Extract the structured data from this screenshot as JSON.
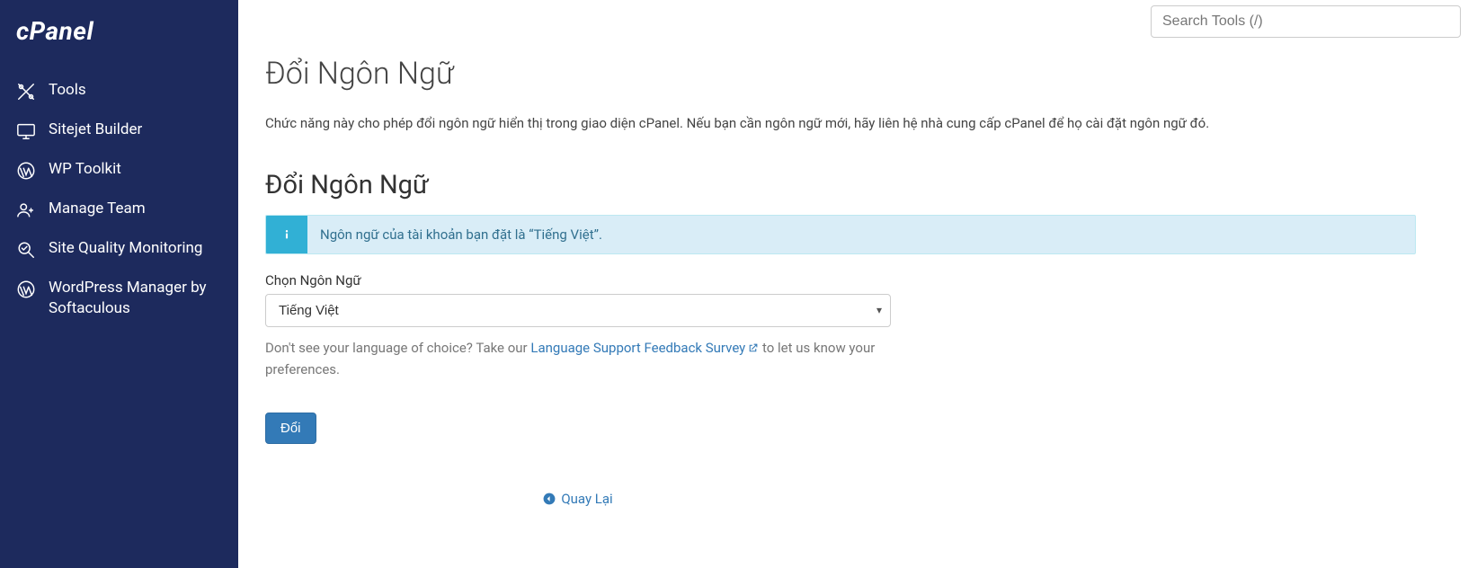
{
  "brand": "cPanel",
  "search": {
    "placeholder": "Search Tools (/)"
  },
  "sidebar": {
    "items": [
      {
        "label": "Tools"
      },
      {
        "label": "Sitejet Builder"
      },
      {
        "label": "WP Toolkit"
      },
      {
        "label": "Manage Team"
      },
      {
        "label": "Site Quality Monitoring"
      },
      {
        "label": "WordPress Manager by Softaculous"
      }
    ]
  },
  "page": {
    "title": "Đổi Ngôn Ngữ",
    "description": "Chức năng này cho phép đổi ngôn ngữ hiển thị trong giao diện cPanel. Nếu bạn cần ngôn ngữ mới, hãy liên hệ nhà cung cấp cPanel để họ cài đặt ngôn ngữ đó.",
    "section_title": "Đổi Ngôn Ngữ",
    "info_message": "Ngôn ngữ của tài khoản bạn đặt là “Tiếng Việt”.",
    "form": {
      "label": "Chọn Ngôn Ngữ",
      "selected": "Tiếng Việt",
      "help_before": "Don't see your language of choice? Take our ",
      "help_link": "Language Support Feedback Survey",
      "help_after": " to let us know your preferences.",
      "submit": "Đổi"
    },
    "back_link": "Quay Lại"
  }
}
